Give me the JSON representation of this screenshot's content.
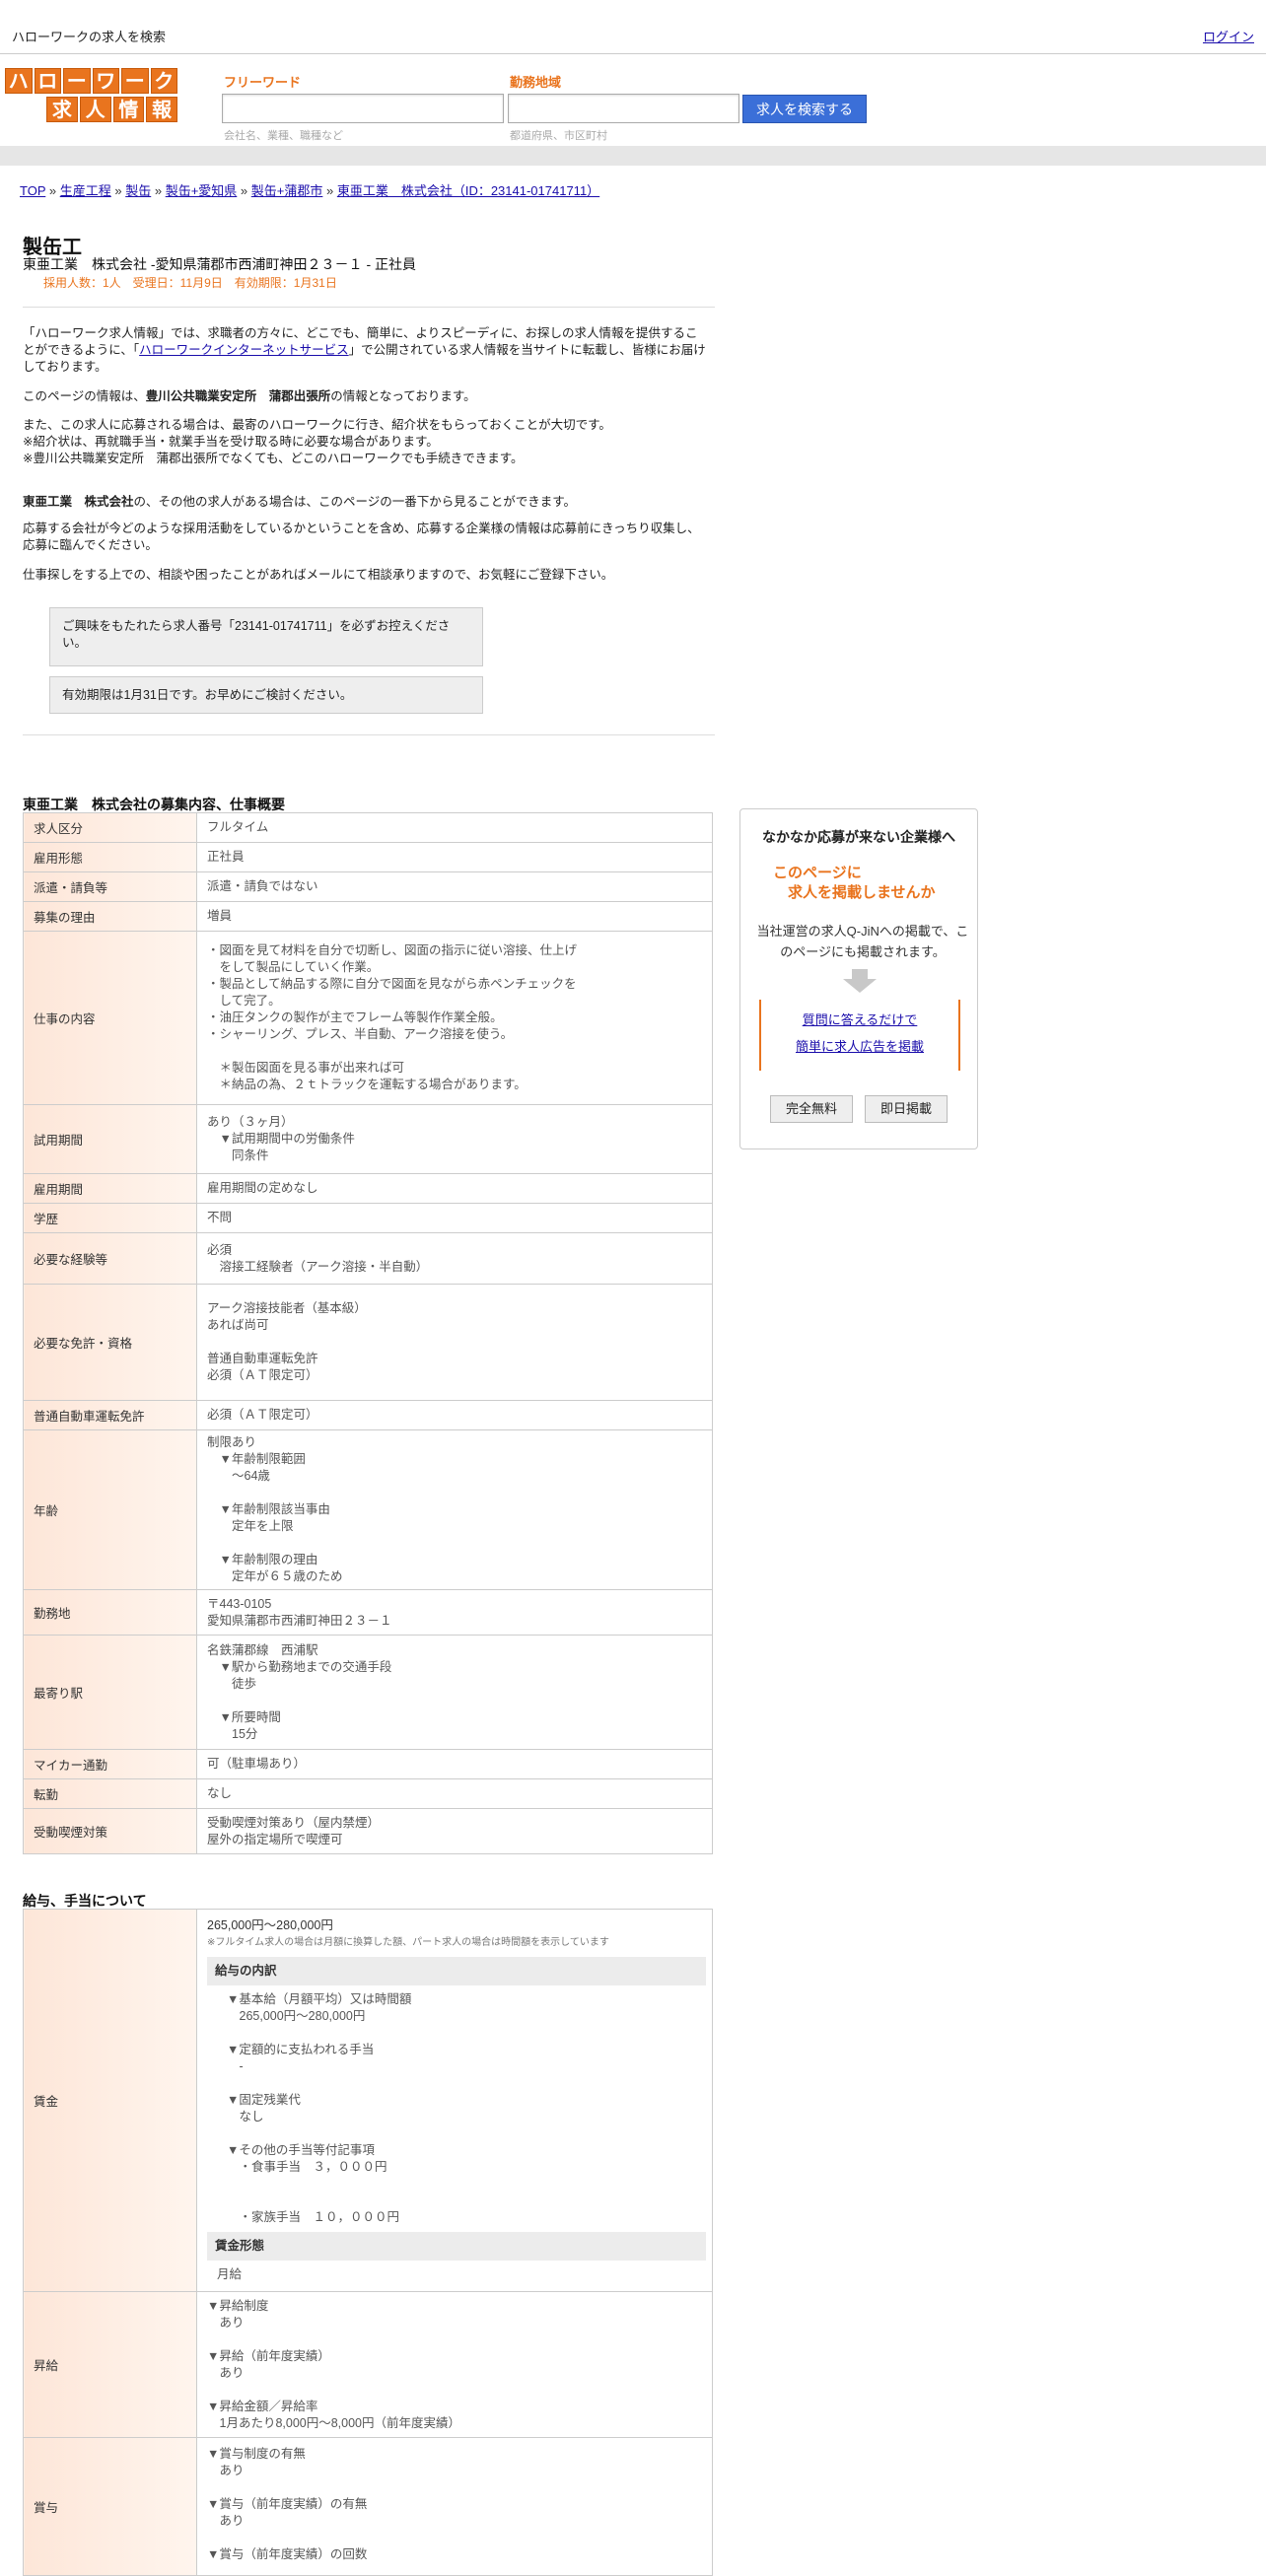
{
  "topbar": {
    "title": "ハローワークの求人を検索",
    "login": "ログイン"
  },
  "logo": {
    "line1": [
      "ハ",
      "ロ",
      "ー",
      "ワ",
      "ー",
      "ク"
    ],
    "line2": [
      "求",
      "人",
      "情",
      "報"
    ]
  },
  "search": {
    "keyword_label": "フリーワード",
    "keyword_hint": "会社名、業種、職種など",
    "area_label": "勤務地域",
    "area_hint": "都道府県、市区町村",
    "button": "求人を検索する"
  },
  "breadcrumb": [
    {
      "text": "TOP"
    },
    {
      "text": "生産工程"
    },
    {
      "text": "製缶"
    },
    {
      "text": "製缶+愛知県"
    },
    {
      "text": "製缶+蒲郡市"
    },
    {
      "text": "東亜工業　株式会社（ID：23141-01741711）"
    }
  ],
  "breadcrumb_sep": " » ",
  "job": {
    "title": "製缶工",
    "subtitle": "東亜工業　株式会社 -愛知県蒲郡市西浦町神田２３－１ - 正社員",
    "meta": "採用人数：1人　受理日：11月9日　有効期限：1月31日"
  },
  "intro": {
    "p1_a": "「ハローワーク求人情報」では、求職者の方々に、どこでも、簡単に、よりスピーディに、お探しの求人情報を提供することができるように、「",
    "p1_link": "ハローワークインターネットサービス",
    "p1_b": "」で公開されている求人情報を当サイトに転載し、皆様にお届けしております。",
    "p2_a": "このページの情報は、",
    "p2_bold": "豊川公共職業安定所　蒲郡出張所",
    "p2_b": "の情報となっております。",
    "p3": "また、この求人に応募される場合は、最寄のハローワークに行き、紹介状をもらっておくことが大切です。\n※紹介状は、再就職手当・就業手当を受け取る時に必要な場合があります。\n※豊川公共職業安定所　蒲郡出張所でなくても、どこのハローワークでも手続きできます。",
    "p4_bold": "東亜工業　株式会社",
    "p4_b": "の、その他の求人がある場合は、このページの一番下から見ることができます。",
    "p5": "応募する会社が今どのような採用活動をしているかということを含め、応募する企業様の情報は応募前にきっちり収集し、応募に臨んでください。",
    "p6": "仕事探しをする上での、相談や困ったことがあればメールにて相談承りますので、お気軽にご登録下さい。"
  },
  "notes": {
    "n1": "ご興味をもたれたら求人番号「23141-01741711」を必ずお控えください。",
    "n2": "有効期限は1月31日です。お早めにご検討ください。"
  },
  "section1": "東亜工業　株式会社の募集内容、仕事概要",
  "rows": [
    {
      "k": "求人区分",
      "v": "フルタイム"
    },
    {
      "k": "雇用形態",
      "v": "正社員"
    },
    {
      "k": "派遣・請負等",
      "v": "派遣・請負ではない"
    },
    {
      "k": "募集の理由",
      "v": "増員"
    },
    {
      "k": "仕事の内容",
      "v": "・図面を見て材料を自分で切断し、図面の指示に従い溶接、仕上げ\n　をして製品にしていく作業。\n・製品として納品する際に自分で図面を見ながら赤ペンチェックを\n　して完了。\n・油圧タンクの製作が主でフレーム等製作作業全般。\n・シャーリング、プレス、半自動、アーク溶接を使う。\n\n　＊製缶図面を見る事が出来れば可\n　＊納品の為、２ｔトラックを運転する場合があります。"
    },
    {
      "k": "試用期間",
      "v": "あり（３ヶ月）\n　▼試用期間中の労働条件\n　　同条件"
    },
    {
      "k": "雇用期間",
      "v": "雇用期間の定めなし"
    },
    {
      "k": "学歴",
      "v": "不問"
    },
    {
      "k": "必要な経験等",
      "v": "必須\n　溶接工経験者（アーク溶接・半自動）"
    },
    {
      "k": "必要な免許・資格",
      "v": "アーク溶接技能者（基本級）\nあれば尚可\n\n普通自動車運転免許\n必須（ＡＴ限定可）"
    },
    {
      "k": "普通自動車運転免許",
      "v": "必須（ＡＴ限定可）"
    },
    {
      "k": "年齢",
      "v": "制限あり\n　▼年齢制限範囲\n　　〜64歳\n\n　▼年齢制限該当事由\n　　定年を上限\n\n　▼年齢制限の理由\n　　定年が６５歳のため"
    },
    {
      "k": "勤務地",
      "v": "〒443-0105\n愛知県蒲郡市西浦町神田２３－１"
    },
    {
      "k": "最寄り駅",
      "v": "名鉄蒲郡線　西浦駅\n　▼駅から勤務地までの交通手段\n　　徒歩\n\n　▼所要時間\n　　15分"
    },
    {
      "k": "マイカー通勤",
      "v": "可（駐車場あり）"
    },
    {
      "k": "転勤",
      "v": "なし"
    },
    {
      "k": "受動喫煙対策",
      "v": "受動喫煙対策あり（屋内禁煙）\n屋外の指定場所で喫煙可"
    }
  ],
  "section2": "給与、手当について",
  "pay": {
    "k_wage": "賃金",
    "range": "265,000円〜280,000円",
    "note": "※フルタイム求人の場合は月額に換算した額、パート求人の場合は時間額を表示しています",
    "breakdown_head": "給与の内訳",
    "breakdown": "▼基本給（月額平均）又は時間額\n　265,000円〜280,000円\n\n▼定額的に支払われる手当\n　-\n\n▼固定残業代\n　なし\n\n▼その他の手当等付記事項\n　・食事手当　３，０００円\n\n\n　・家族手当　１０，０００円",
    "form_head": "賃金形態",
    "form": "月給",
    "k_raise": "昇給",
    "raise": "▼昇給制度\n　あり\n\n▼昇給（前年度実績）\n　あり\n\n▼昇給金額／昇給率\n　1月あたり8,000円〜8,000円（前年度実績）",
    "k_bonus": "賞与",
    "bonus": "▼賞与制度の有無\n　あり\n\n▼賞与（前年度実績）の有無\n　あり\n\n▼賞与（前年度実績）の回数"
  },
  "sidebar": {
    "heading": "なかなか応募が来ない企業様へ",
    "offer1": "このページに",
    "offer2": "求人を掲載しませんか",
    "desc": "当社運営の求人Q-JiNへの掲載で、このページにも掲載されます。",
    "link1": "質問に答えるだけで",
    "link2": "簡単に求人広告を掲載",
    "btn_free": "完全無料",
    "btn_same_day": "即日掲載"
  }
}
